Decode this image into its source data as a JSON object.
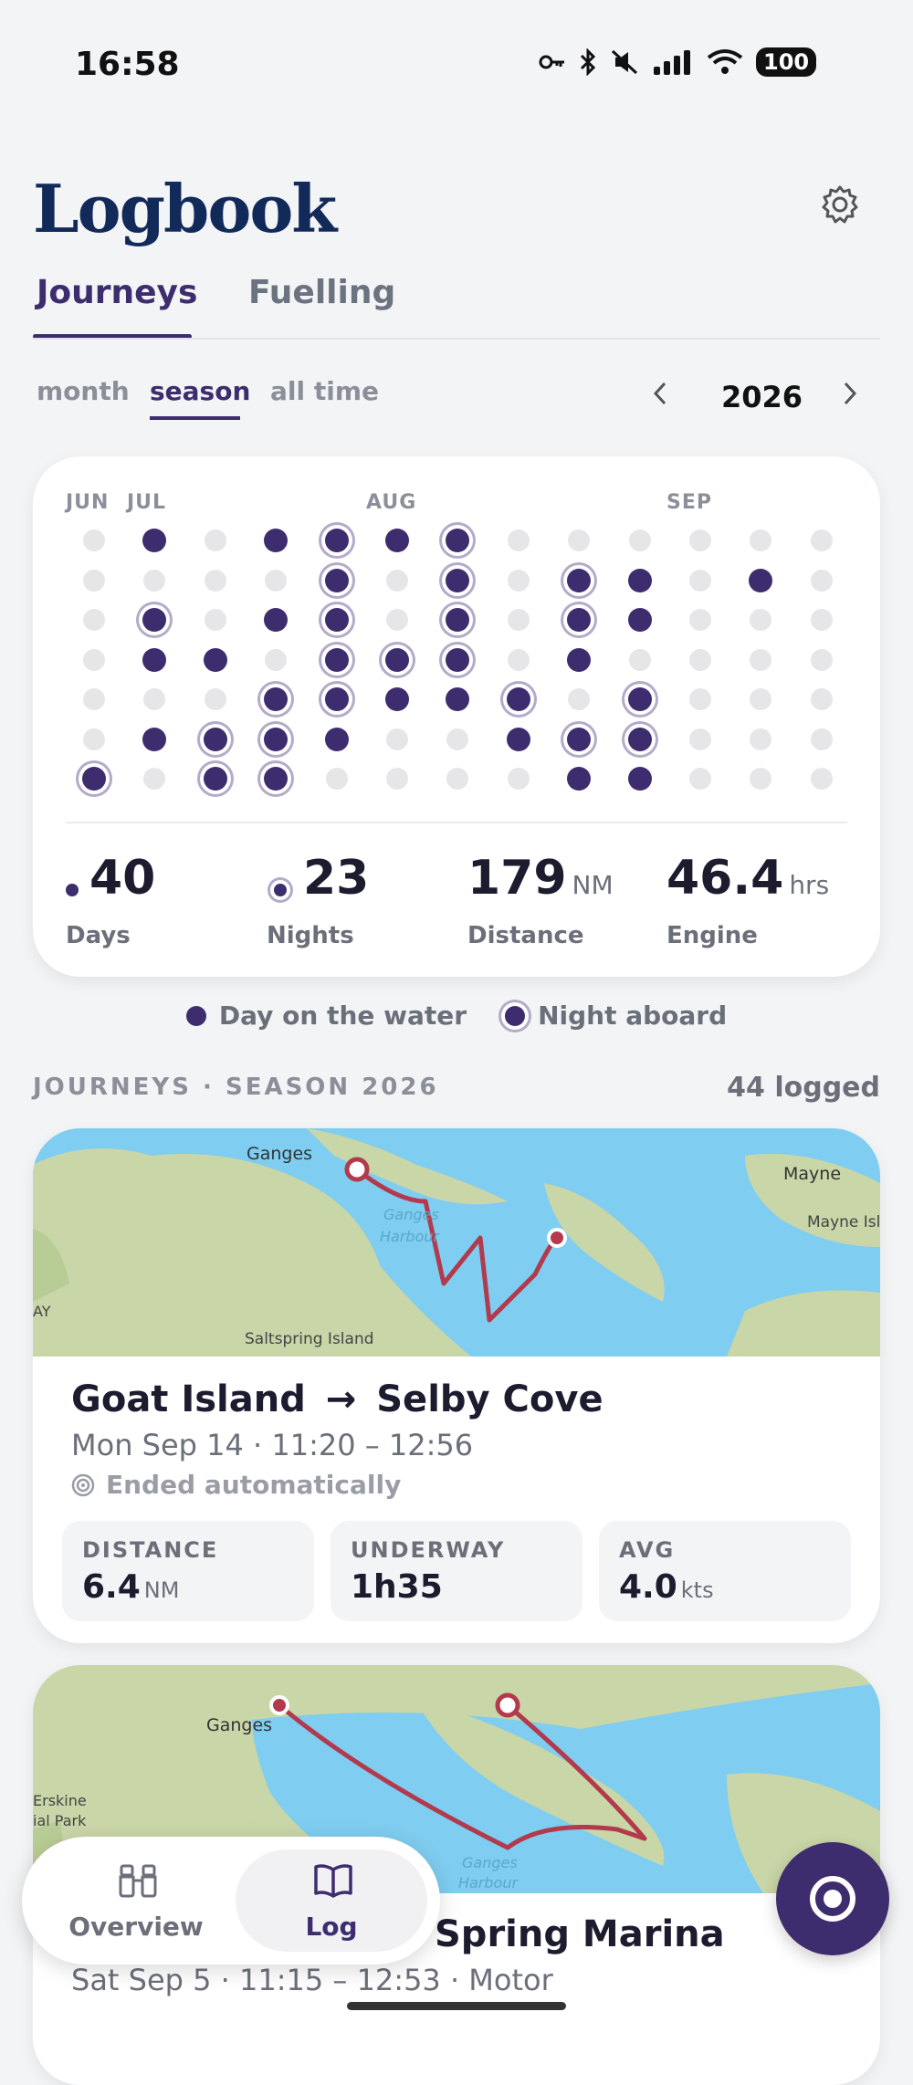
{
  "status_bar": {
    "time": "16:58",
    "battery": "100",
    "icons": [
      "key-icon",
      "bluetooth-icon",
      "mute-icon",
      "signal-icon",
      "wifi-icon",
      "battery-icon"
    ]
  },
  "header": {
    "title": "Logbook",
    "settings_icon": "gear-icon"
  },
  "tabs": [
    {
      "label": "Journeys",
      "active": true
    },
    {
      "label": "Fuelling",
      "active": false
    }
  ],
  "range_filter": {
    "options": [
      "month",
      "season",
      "all time"
    ],
    "selected": "season"
  },
  "year_nav": {
    "year": "2026",
    "prev_icon": "chevron-left-icon",
    "next_icon": "chevron-right-icon"
  },
  "calendar": {
    "month_labels": [
      "JUN",
      "JUL",
      "AUG",
      "SEP"
    ],
    "states_by_column": [
      [
        0,
        0,
        0,
        0,
        0,
        0,
        2
      ],
      [
        1,
        0,
        2,
        1,
        0,
        1,
        0
      ],
      [
        0,
        0,
        0,
        1,
        0,
        2,
        2
      ],
      [
        1,
        0,
        1,
        0,
        2,
        2,
        2
      ],
      [
        2,
        2,
        2,
        2,
        2,
        1,
        0
      ],
      [
        1,
        0,
        0,
        2,
        1,
        0,
        0
      ],
      [
        2,
        2,
        2,
        2,
        1,
        0,
        0
      ],
      [
        0,
        0,
        0,
        0,
        2,
        1,
        0
      ],
      [
        0,
        2,
        2,
        1,
        0,
        2,
        1
      ],
      [
        0,
        1,
        1,
        0,
        2,
        2,
        1
      ],
      [
        0,
        0,
        0,
        0,
        0,
        0,
        0
      ],
      [
        0,
        1,
        0,
        0,
        0,
        0,
        0
      ],
      [
        0,
        0,
        0,
        0,
        0,
        0,
        0
      ]
    ],
    "state_legend": {
      "0": "empty",
      "1": "day",
      "2": "night"
    }
  },
  "stats": {
    "days": {
      "value": "40",
      "label": "Days"
    },
    "nights": {
      "value": "23",
      "label": "Nights"
    },
    "distance": {
      "value": "179",
      "unit": "NM",
      "label": "Distance"
    },
    "engine": {
      "value": "46.4",
      "unit": "hrs",
      "label": "Engine"
    }
  },
  "legend": {
    "day": "Day on the water",
    "night": "Night aboard"
  },
  "section": {
    "title": "JOURNEYS · SEASON 2026",
    "count": "44 logged"
  },
  "journeys": [
    {
      "title_from": "Goat Island",
      "title_to": "Selby Cove",
      "date": "Mon Sep 14 · 11:20 – 12:56",
      "auto_end": "Ended automatically",
      "map_labels": {
        "a": "Ganges",
        "b": "Mayne",
        "c": "Mayne Isla",
        "d": "Saltspring Island",
        "e": "Ganges",
        "f": "Harbour",
        "g": "AY"
      },
      "metrics": [
        {
          "label": "DISTANCE",
          "value": "6.4",
          "unit": "NM"
        },
        {
          "label": "UNDERWAY",
          "value": "1h35",
          "unit": ""
        },
        {
          "label": "AVG",
          "value": "4.0",
          "unit": "kts"
        }
      ]
    },
    {
      "title_visible": "Spring Marina",
      "date": "Sat Sep 5 · 11:15 – 12:53 · Motor",
      "map_labels": {
        "a": "Ganges",
        "b": "Erskine",
        "c": "ial Park",
        "d": "Ganges",
        "e": "Harbour"
      }
    }
  ],
  "bottom_nav": [
    {
      "label": "Overview",
      "icon": "binoculars-icon",
      "active": false
    },
    {
      "label": "Log",
      "icon": "book-icon",
      "active": true
    }
  ],
  "record_button_icon": "record-icon",
  "colors": {
    "accent": "#3e2d6e",
    "title": "#122a5a",
    "route": "#b23a4c",
    "water": "#7fcdf0",
    "land": "#c9d6a8"
  }
}
